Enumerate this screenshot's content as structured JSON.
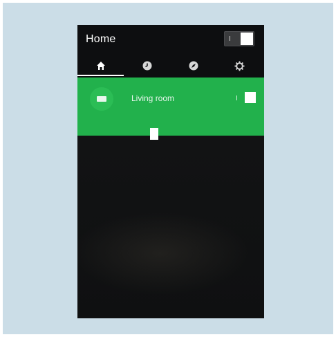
{
  "header": {
    "title": "Home"
  },
  "master_switch": {
    "on_label": "I",
    "state": "on"
  },
  "tabs": [
    {
      "icon": "home-icon",
      "active": true
    },
    {
      "icon": "clock-icon",
      "active": false
    },
    {
      "icon": "compass-icon",
      "active": false
    },
    {
      "icon": "gear-icon",
      "active": false
    }
  ],
  "rooms": [
    {
      "name": "Living room",
      "icon": "lamp-icon",
      "switch_label": "I",
      "state": "on"
    }
  ],
  "colors": {
    "accent": "#22b14c",
    "background": "#101112",
    "frame": "#cbdde7"
  }
}
